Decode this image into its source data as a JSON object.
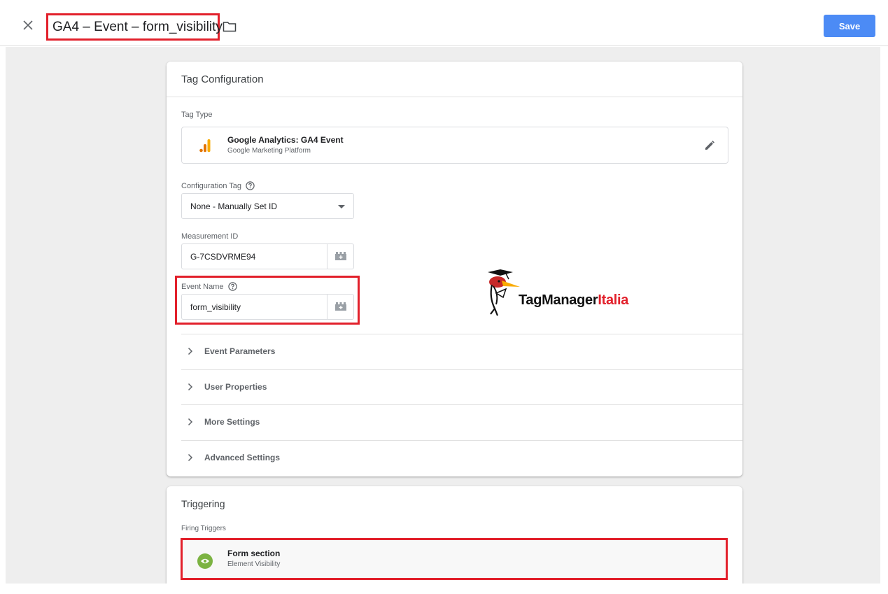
{
  "header": {
    "title": "GA4 – Event – form_visibility",
    "save_label": "Save",
    "close_icon": "close-icon",
    "folder_icon": "folder-icon"
  },
  "tag_configuration": {
    "title": "Tag Configuration",
    "tag_type": {
      "label": "Tag Type",
      "name": "Google Analytics: GA4 Event",
      "provider": "Google Marketing Platform",
      "icon": "google-analytics-icon"
    },
    "configuration_tag": {
      "label": "Configuration Tag",
      "value": "None - Manually Set ID"
    },
    "measurement_id": {
      "label": "Measurement ID",
      "value": "G-7CSDVRME94"
    },
    "event_name": {
      "label": "Event Name",
      "value": "form_visibility"
    },
    "sections": [
      {
        "label": "Event Parameters"
      },
      {
        "label": "User Properties"
      },
      {
        "label": "More Settings"
      },
      {
        "label": "Advanced Settings"
      }
    ]
  },
  "triggering": {
    "title": "Triggering",
    "firing_label": "Firing Triggers",
    "triggers": [
      {
        "name": "Form section",
        "type": "Element Visibility",
        "icon": "eye-icon",
        "color": "#7cb342"
      }
    ]
  },
  "watermark": {
    "text_a": "TagManager",
    "text_b": "Italia"
  },
  "colors": {
    "accent": "#4c8bf5",
    "highlight": "#e2202b"
  }
}
